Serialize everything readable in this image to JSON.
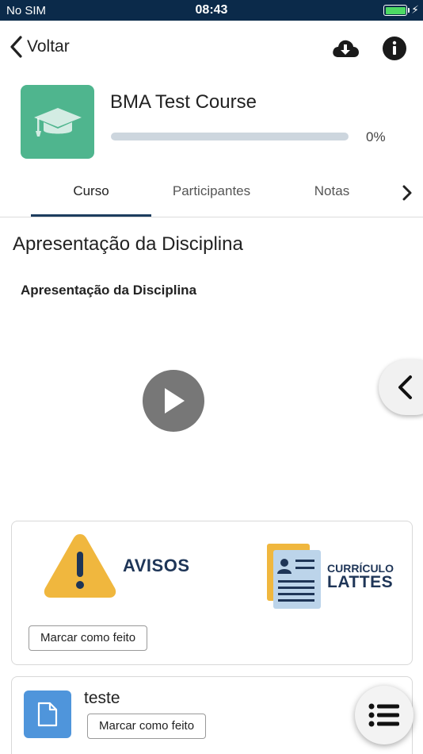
{
  "status_bar": {
    "carrier": "No SIM",
    "time": "08:43",
    "battery_level": 1.0
  },
  "nav": {
    "back_label": "Voltar",
    "download_icon": "cloud-download-icon",
    "info_icon": "info-icon"
  },
  "course": {
    "title": "BMA Test Course",
    "progress_percent": 0,
    "progress_text": "0%",
    "icon": "graduation-cap-icon",
    "thumb_color": "#4fb58e"
  },
  "tabs": [
    {
      "label": "Curso",
      "active": true
    },
    {
      "label": "Participantes",
      "active": false
    },
    {
      "label": "Notas",
      "active": false
    }
  ],
  "section": {
    "title": "Apresentação da Disciplina",
    "subtitle": "Apresentação da Disciplina"
  },
  "media": {
    "play_icon": "play-icon"
  },
  "cards": [
    {
      "images": [
        {
          "text": "AVISOS"
        },
        {
          "line1": "CURRÍCULO",
          "line2": "LATTES"
        }
      ],
      "button": "Marcar como feito"
    },
    {
      "file_name": "teste",
      "icon": "file-icon",
      "button": "Marcar como feito"
    }
  ],
  "colors": {
    "primary": "#1d3d5e",
    "accent_blue": "#4f95db",
    "warning": "#f0b73e",
    "status_bar": "#0b2a4a"
  }
}
